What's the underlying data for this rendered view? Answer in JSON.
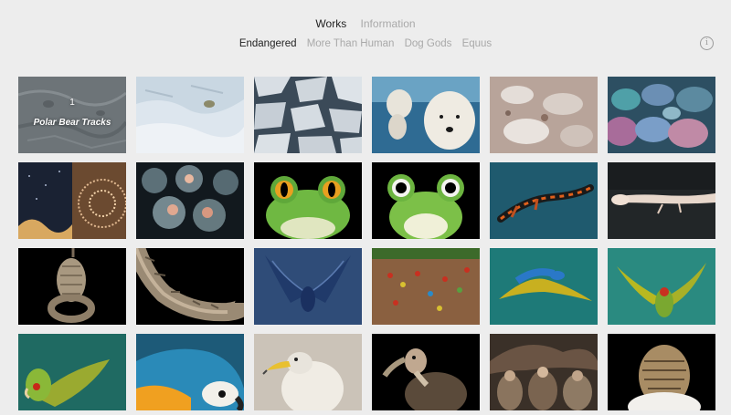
{
  "nav": {
    "primary": [
      {
        "label": "Works",
        "active": true
      },
      {
        "label": "Information",
        "active": false
      }
    ],
    "secondary": [
      {
        "label": "Endangered",
        "active": true
      },
      {
        "label": "More Than Human",
        "active": false
      },
      {
        "label": "Dog Gods",
        "active": false
      },
      {
        "label": "Equus",
        "active": false
      }
    ],
    "info_icon": "info-circle-icon"
  },
  "gallery": {
    "first_tile": {
      "number": "1",
      "title": "Polar Bear Tracks"
    },
    "tiles": [
      {
        "subject": "polar bear tracks"
      },
      {
        "subject": "snowy ice"
      },
      {
        "subject": "broken sea ice"
      },
      {
        "subject": "polar bears underwater"
      },
      {
        "subject": "ice with rocks"
      },
      {
        "subject": "coral reef"
      },
      {
        "subject": "coral split"
      },
      {
        "subject": "frog eggs"
      },
      {
        "subject": "green tree frog"
      },
      {
        "subject": "green tree frog"
      },
      {
        "subject": "salamander"
      },
      {
        "subject": "axolotl"
      },
      {
        "subject": "pangolin hanging"
      },
      {
        "subject": "pangolin walking"
      },
      {
        "subject": "blue bird wings"
      },
      {
        "subject": "macaws clay lick"
      },
      {
        "subject": "blue macaw flying"
      },
      {
        "subject": "green parrot flying"
      },
      {
        "subject": "green parrot"
      },
      {
        "subject": "blue and yellow macaw"
      },
      {
        "subject": "egyptian vulture"
      },
      {
        "subject": "vulture"
      },
      {
        "subject": "vultures group"
      },
      {
        "subject": "eagle back"
      }
    ]
  }
}
